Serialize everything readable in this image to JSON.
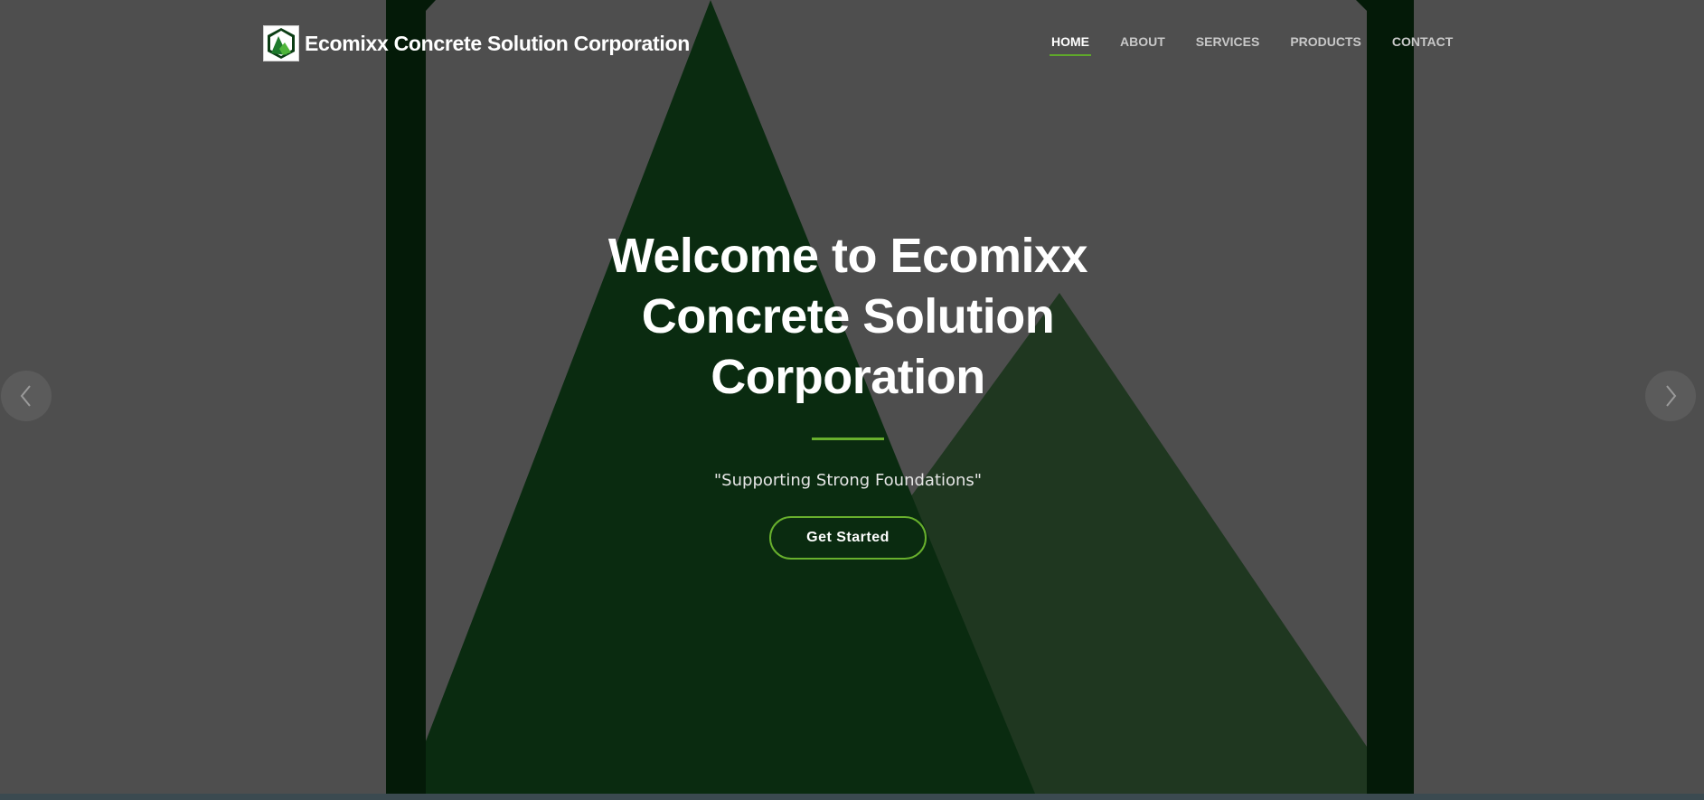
{
  "brand": {
    "name": "Ecomixx Concrete Solution Corporation",
    "logo_icon": "mountain-hexagon-logo-icon"
  },
  "nav": {
    "items": [
      {
        "label": "HOME",
        "active": true
      },
      {
        "label": "ABOUT",
        "active": false
      },
      {
        "label": "SERVICES",
        "active": false
      },
      {
        "label": "PRODUCTS",
        "active": false
      },
      {
        "label": "CONTACT",
        "active": false
      }
    ]
  },
  "hero": {
    "title_line_1": "Welcome to Ecomixx",
    "title_line_2": "Concrete Solution",
    "title_line_3": "Corporation",
    "tagline": "\"Supporting Strong Foundations\"",
    "cta_label": "Get Started"
  },
  "carousel": {
    "prev_icon": "chevron-left-icon",
    "next_icon": "chevron-right-icon"
  },
  "colors": {
    "accent": "#68b02d",
    "overlay": "#4e4e4e",
    "mountain_dark": "#0a2a10",
    "mountain_light": "#1f3720"
  }
}
